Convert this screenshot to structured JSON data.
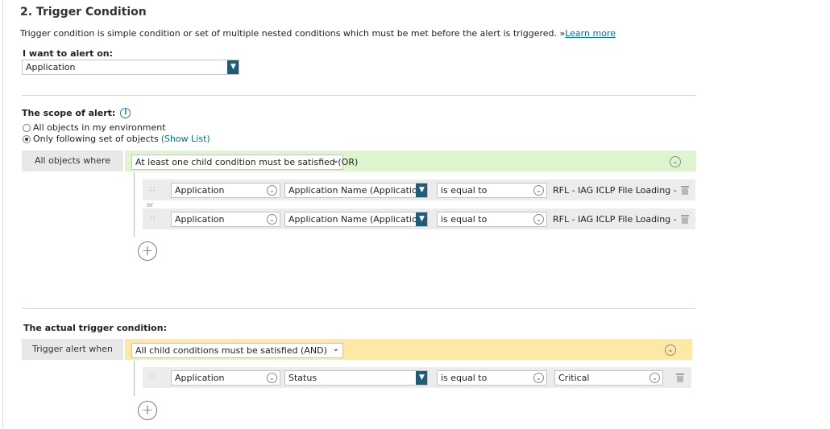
{
  "section": {
    "title": "2. Trigger Condition",
    "description": "Trigger condition is simple condition or set of multiple nested conditions which must be met before the alert is triggered. »",
    "learn_more": "Learn more"
  },
  "alert_on": {
    "label": "I want to alert on:",
    "value": "Application"
  },
  "scope": {
    "label": "The scope of alert:",
    "info_icon": "i",
    "option_all": "All objects in my environment",
    "option_following": "Only following set of objects",
    "show_list": "(Show List)",
    "selected": "Only following set of objects",
    "group_label": "All objects where",
    "group_mode": "At least one child condition must be satisfied (OR)",
    "or_label": "or",
    "conditions": [
      {
        "entity": "Application",
        "property": "Application Name (Application Al",
        "operator": "is equal to",
        "value": "RFL - IAG ICLP File Loading -"
      },
      {
        "entity": "Application",
        "property": "Application Name (Application Al",
        "operator": "is equal to",
        "value": "RFL - IAG ICLP File Loading -"
      }
    ]
  },
  "trigger": {
    "label": "The actual trigger condition:",
    "group_label": "Trigger alert when",
    "group_mode": "All child conditions must be satisfied (AND)",
    "conditions": [
      {
        "entity": "Application",
        "property": "Status",
        "operator": "is equal to",
        "value": "Critical"
      }
    ]
  },
  "icons": {
    "plus": "+",
    "collapse": "chevron-down-circle-icon",
    "dropdown_arrow": "⌄",
    "drag_handle": "∷"
  },
  "colors": {
    "accent_dark": "#1e5c7a",
    "link": "#006ca9",
    "scope_bar": "#dff5cf",
    "trigger_bar": "#fde8a6"
  }
}
